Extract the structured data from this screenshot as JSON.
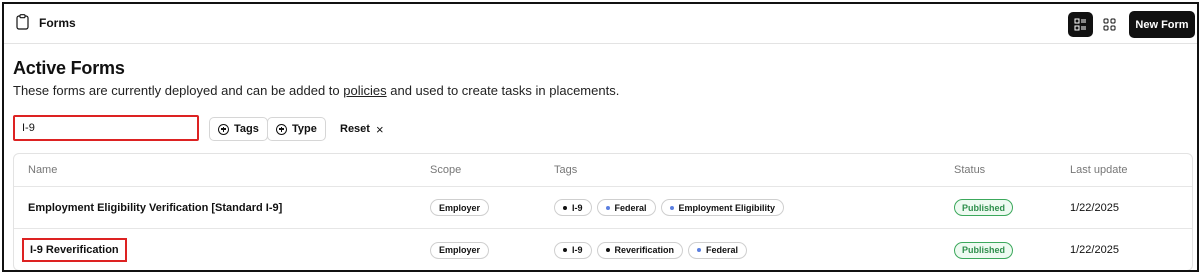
{
  "topbar": {
    "title": "Forms",
    "new_form_label": "New Form",
    "icons": [
      "clipboard-icon",
      "list-view-icon",
      "grid-view-icon"
    ]
  },
  "page": {
    "heading": "Active Forms",
    "desc_before": "These forms are currently deployed and can be added to ",
    "desc_link": "policies",
    "desc_after": " and used to create tasks in placements."
  },
  "filters": {
    "search_value": "I-9",
    "tags_label": "Tags",
    "type_label": "Type",
    "reset_label": "Reset",
    "reset_icon": "×"
  },
  "table": {
    "columns": [
      "Name",
      "Scope",
      "Tags",
      "Status",
      "Last update"
    ],
    "rows": [
      {
        "name": "Employment Eligibility Verification [Standard I-9]",
        "scope": "Employer",
        "tags": [
          {
            "label": "I-9",
            "color": "#111111"
          },
          {
            "label": "Federal",
            "color": "#5b7fe0"
          },
          {
            "label": "Employment Eligibility",
            "color": "#5b7fe0"
          }
        ],
        "status": "Published",
        "last_update": "1/22/2025"
      },
      {
        "name": "I-9 Reverification",
        "scope": "Employer",
        "tags": [
          {
            "label": "I-9",
            "color": "#111111"
          },
          {
            "label": "Reverification",
            "color": "#111111"
          },
          {
            "label": "Federal",
            "color": "#5b7fe0"
          }
        ],
        "status": "Published",
        "last_update": "1/22/2025"
      }
    ]
  },
  "colors": {
    "accent": "#111111",
    "highlight": "#dd2222",
    "status_green": "#2f8f4c"
  }
}
